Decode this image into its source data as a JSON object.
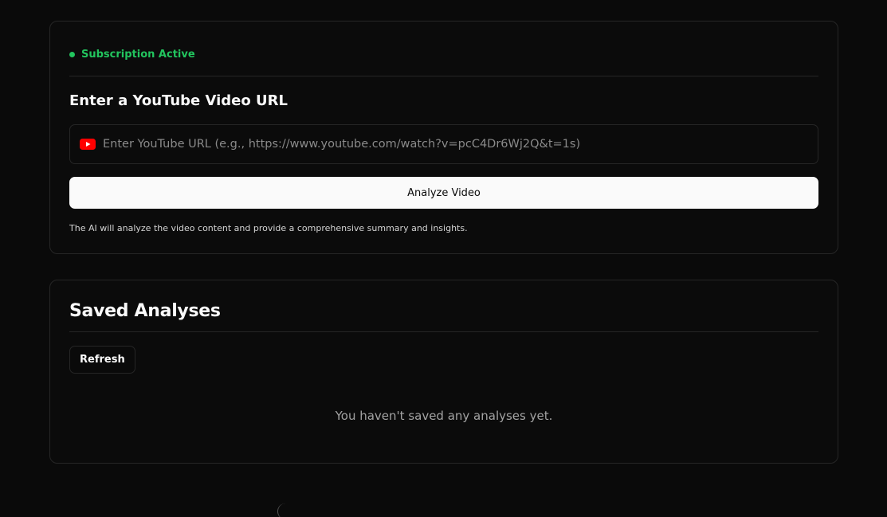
{
  "subscription": {
    "status_label": "Subscription Active",
    "status_color": "#22c55e"
  },
  "analyze": {
    "title": "Enter a YouTube Video URL",
    "url_placeholder": "Enter YouTube URL (e.g., https://www.youtube.com/watch?v=pcC4Dr6Wj2Q&t=1s)",
    "url_value": "",
    "url_icon": "youtube-icon",
    "button_label": "Analyze Video",
    "helper_text": "The AI will analyze the video content and provide a comprehensive summary and insights."
  },
  "saved": {
    "title": "Saved Analyses",
    "refresh_label": "Refresh",
    "empty_message": "You haven't saved any analyses yet."
  },
  "colors": {
    "background": "#0a0a0a",
    "border": "#262626",
    "youtube_red": "#ff0000"
  }
}
